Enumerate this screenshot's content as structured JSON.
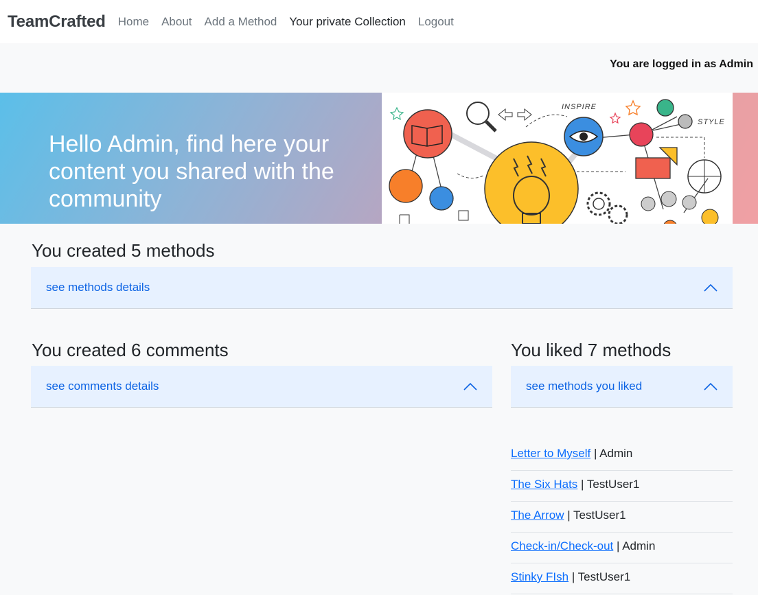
{
  "nav": {
    "brand": "TeamCrafted",
    "links": [
      "Home",
      "About",
      "Add a Method",
      "Your private Collection",
      "Logout"
    ]
  },
  "status": {
    "logged_in": "You are logged in as Admin"
  },
  "hero": {
    "text": "Hello Admin, find here your content you shared with the community",
    "image_words": {
      "inspire": "INSPIRE",
      "style": "STYLE"
    }
  },
  "sections": {
    "methods": {
      "title": "You created 5 methods",
      "toggle": "see methods details"
    },
    "comments": {
      "title": "You created 6 comments",
      "toggle": "see comments details"
    },
    "liked": {
      "title": "You liked 7 methods",
      "toggle": "see methods you liked"
    }
  },
  "liked_items": [
    {
      "title": "Letter to Myself",
      "author": "Admin"
    },
    {
      "title": "The Six Hats",
      "author": "TestUser1"
    },
    {
      "title": "The Arrow",
      "author": "TestUser1"
    },
    {
      "title": "Check-in/Check-out",
      "author": "Admin"
    },
    {
      "title": "Stinky FIsh",
      "author": "TestUser1"
    }
  ],
  "colors": {
    "accordion_bg": "#e7f1ff",
    "accordion_text": "#0c63e4",
    "link": "#0d6efd",
    "page_bg": "#f8f9fa"
  }
}
